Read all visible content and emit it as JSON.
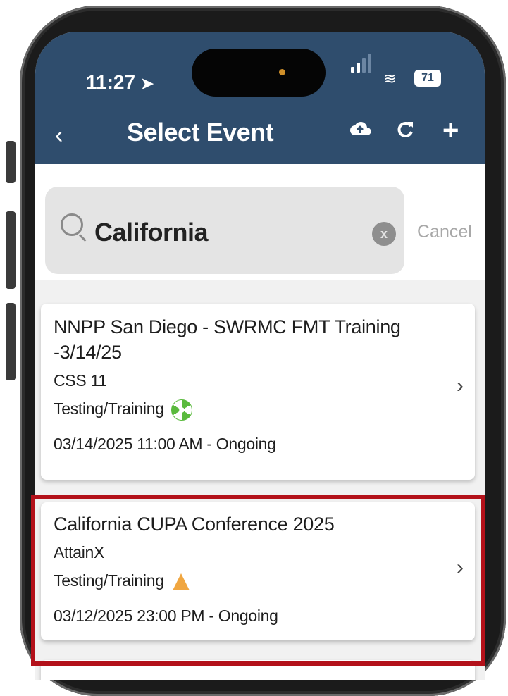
{
  "status_bar": {
    "time": "11:27",
    "battery": "71"
  },
  "header": {
    "back_glyph": "‹",
    "title": "Select Event"
  },
  "search": {
    "query": "California",
    "cancel_label": "Cancel"
  },
  "events": [
    {
      "title_line1": "NNPP San Diego - SWRMC FMT Training",
      "title_line2": "-3/14/25",
      "organization": "CSS 11",
      "category": "Testing/Training",
      "category_icon": "radiation-hazard-icon",
      "datetime": "03/14/2025 11:00 AM - Ongoing"
    },
    {
      "title_line1": "California CUPA Conference 2025",
      "organization": "AttainX",
      "category": "Testing/Training",
      "category_icon": "flask-icon",
      "datetime": "03/12/2025 23:00 PM - Ongoing"
    }
  ],
  "colors": {
    "header": "#2f4d6d",
    "highlight": "#b3111a"
  }
}
